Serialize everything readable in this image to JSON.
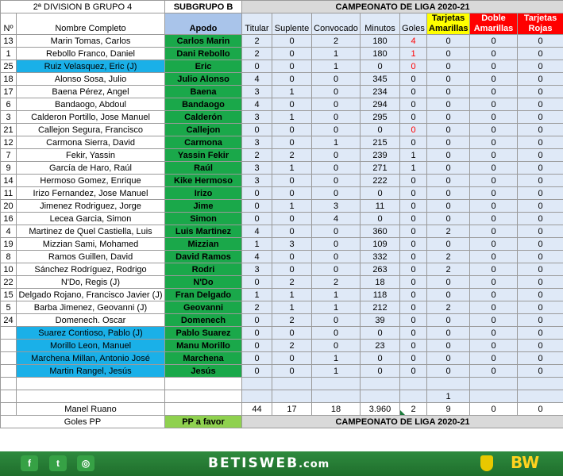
{
  "header": {
    "division": "2ª DIVISION B GRUPO 4",
    "subgrupo": "SUBGRUPO B",
    "campeonato": "CAMPEONATO  DE LIGA 2020-21",
    "cols": {
      "no": "Nº",
      "nombre": "Nombre Completo",
      "apodo": "Apodo",
      "titular": "Titular",
      "suplente": "Suplente",
      "convocado": "Convocado",
      "minutos": "Minutos",
      "goles": "Goles",
      "amarillas": "Tarjetas Amarillas",
      "doble": "Doble Amarillas",
      "rojas": "Tarjetas Rojas"
    }
  },
  "colors": {
    "green": "#1aa84a",
    "blue": "#1ab0e8",
    "yellow": "#ffff00",
    "red": "#ff0000",
    "apodo_header": "#a9c4ea"
  },
  "players": [
    {
      "no": "13",
      "name": "Marin Tomas, Carlos",
      "apodo": "Carlos Marin",
      "tit": "2",
      "sup": "0",
      "conv": "2",
      "min": "180",
      "gol": "4",
      "am": "0",
      "dob": "0",
      "roj": "0",
      "blue": false,
      "red": true
    },
    {
      "no": "1",
      "name": "Rebollo Franco, Daniel",
      "apodo": "Dani Rebollo",
      "tit": "2",
      "sup": "0",
      "conv": "1",
      "min": "180",
      "gol": "1",
      "am": "0",
      "dob": "0",
      "roj": "0",
      "blue": false,
      "red": true
    },
    {
      "no": "25",
      "name": "Ruiz Velasquez, Eric   (J)",
      "apodo": "Eric",
      "tit": "0",
      "sup": "0",
      "conv": "1",
      "min": "0",
      "gol": "0",
      "am": "0",
      "dob": "0",
      "roj": "0",
      "blue": true,
      "red": true
    },
    {
      "no": "18",
      "name": "Alonso Sosa, Julio",
      "apodo": "Julio Alonso",
      "tit": "4",
      "sup": "0",
      "conv": "0",
      "min": "345",
      "gol": "0",
      "am": "0",
      "dob": "0",
      "roj": "0",
      "blue": false,
      "red": false
    },
    {
      "no": "17",
      "name": "Baena Pérez, Angel",
      "apodo": "Baena",
      "tit": "3",
      "sup": "1",
      "conv": "0",
      "min": "234",
      "gol": "0",
      "am": "0",
      "dob": "0",
      "roj": "0",
      "blue": false,
      "red": false
    },
    {
      "no": "6",
      "name": "Bandaogo, Abdoul",
      "apodo": "Bandaogo",
      "tit": "4",
      "sup": "0",
      "conv": "0",
      "min": "294",
      "gol": "0",
      "am": "0",
      "dob": "0",
      "roj": "0",
      "blue": false,
      "red": false
    },
    {
      "no": "3",
      "name": "Calderon Portillo, Jose Manuel",
      "apodo": "Calderón",
      "tit": "3",
      "sup": "1",
      "conv": "0",
      "min": "295",
      "gol": "0",
      "am": "0",
      "dob": "0",
      "roj": "0",
      "blue": false,
      "red": false
    },
    {
      "no": "21",
      "name": "Callejon Segura, Francisco",
      "apodo": "Callejon",
      "tit": "0",
      "sup": "0",
      "conv": "0",
      "min": "0",
      "gol": "0",
      "am": "0",
      "dob": "0",
      "roj": "0",
      "blue": false,
      "red": true
    },
    {
      "no": "12",
      "name": "Carmona Sierra, David",
      "apodo": "Carmona",
      "tit": "3",
      "sup": "0",
      "conv": "1",
      "min": "215",
      "gol": "0",
      "am": "0",
      "dob": "0",
      "roj": "0",
      "blue": false,
      "red": false
    },
    {
      "no": "7",
      "name": "Fekir, Yassin",
      "apodo": "Yassin Fekir",
      "tit": "2",
      "sup": "2",
      "conv": "0",
      "min": "239",
      "gol": "1",
      "am": "0",
      "dob": "0",
      "roj": "0",
      "blue": false,
      "red": false
    },
    {
      "no": "9",
      "name": "García de Haro, Raúl",
      "apodo": "Raúl",
      "tit": "3",
      "sup": "1",
      "conv": "0",
      "min": "271",
      "gol": "1",
      "am": "0",
      "dob": "0",
      "roj": "0",
      "blue": false,
      "red": false
    },
    {
      "no": "14",
      "name": "Hermoso Gomez, Enrique",
      "apodo": "Kike Hermoso",
      "tit": "3",
      "sup": "0",
      "conv": "0",
      "min": "222",
      "gol": "0",
      "am": "0",
      "dob": "0",
      "roj": "0",
      "blue": false,
      "red": false
    },
    {
      "no": "11",
      "name": "Irizo Fernandez, Jose Manuel",
      "apodo": "Irizo",
      "tit": "0",
      "sup": "0",
      "conv": "0",
      "min": "0",
      "gol": "0",
      "am": "0",
      "dob": "0",
      "roj": "0",
      "blue": false,
      "red": false
    },
    {
      "no": "20",
      "name": "Jimenez Rodriguez, Jorge",
      "apodo": "Jime",
      "tit": "0",
      "sup": "1",
      "conv": "3",
      "min": "11",
      "gol": "0",
      "am": "0",
      "dob": "0",
      "roj": "0",
      "blue": false,
      "red": false
    },
    {
      "no": "16",
      "name": "Lecea Garcia, Simon",
      "apodo": "Simon",
      "tit": "0",
      "sup": "0",
      "conv": "4",
      "min": "0",
      "gol": "0",
      "am": "0",
      "dob": "0",
      "roj": "0",
      "blue": false,
      "red": false
    },
    {
      "no": "4",
      "name": "Martinez de Quel Castiella, Luis",
      "apodo": "Luis Martinez",
      "tit": "4",
      "sup": "0",
      "conv": "0",
      "min": "360",
      "gol": "0",
      "am": "2",
      "dob": "0",
      "roj": "0",
      "blue": false,
      "red": false
    },
    {
      "no": "19",
      "name": "Mizzian Sami, Mohamed",
      "apodo": "Mizzian",
      "tit": "1",
      "sup": "3",
      "conv": "0",
      "min": "109",
      "gol": "0",
      "am": "0",
      "dob": "0",
      "roj": "0",
      "blue": false,
      "red": false
    },
    {
      "no": "8",
      "name": "Ramos Guillen, David",
      "apodo": "David Ramos",
      "tit": "4",
      "sup": "0",
      "conv": "0",
      "min": "332",
      "gol": "0",
      "am": "2",
      "dob": "0",
      "roj": "0",
      "blue": false,
      "red": false
    },
    {
      "no": "10",
      "name": "Sánchez Rodríguez, Rodrigo",
      "apodo": "Rodri",
      "tit": "3",
      "sup": "0",
      "conv": "0",
      "min": "263",
      "gol": "0",
      "am": "2",
      "dob": "0",
      "roj": "0",
      "blue": false,
      "red": false
    },
    {
      "no": "22",
      "name": "N'Do, Regis (J)",
      "apodo": "N'Do",
      "tit": "0",
      "sup": "2",
      "conv": "2",
      "min": "18",
      "gol": "0",
      "am": "0",
      "dob": "0",
      "roj": "0",
      "blue": false,
      "red": false
    },
    {
      "no": "15",
      "name": "Delgado Rojano, Francisco Javier (J)",
      "apodo": "Fran Delgado",
      "tit": "1",
      "sup": "1",
      "conv": "1",
      "min": "118",
      "gol": "0",
      "am": "0",
      "dob": "0",
      "roj": "0",
      "blue": false,
      "red": false
    },
    {
      "no": "5",
      "name": "Barba Jimenez, Geovanni (J)",
      "apodo": "Geovanni",
      "tit": "2",
      "sup": "1",
      "conv": "1",
      "min": "212",
      "gol": "0",
      "am": "2",
      "dob": "0",
      "roj": "0",
      "blue": false,
      "red": false
    },
    {
      "no": "24",
      "name": "Domenech. Oscar",
      "apodo": "Domenech",
      "tit": "0",
      "sup": "2",
      "conv": "0",
      "min": "39",
      "gol": "0",
      "am": "0",
      "dob": "0",
      "roj": "0",
      "blue": false,
      "red": false
    },
    {
      "no": "",
      "name": "Suarez Contioso, Pablo (J)",
      "apodo": "Pablo Suarez",
      "tit": "0",
      "sup": "0",
      "conv": "0",
      "min": "0",
      "gol": "0",
      "am": "0",
      "dob": "0",
      "roj": "0",
      "blue": true,
      "red": false
    },
    {
      "no": "",
      "name": "Morillo Leon, Manuel",
      "apodo": "Manu Morillo",
      "tit": "0",
      "sup": "2",
      "conv": "0",
      "min": "23",
      "gol": "0",
      "am": "0",
      "dob": "0",
      "roj": "0",
      "blue": true,
      "red": false
    },
    {
      "no": "",
      "name": "Marchena Millan, Antonio José",
      "apodo": "Marchena",
      "tit": "0",
      "sup": "0",
      "conv": "1",
      "min": "0",
      "gol": "0",
      "am": "0",
      "dob": "0",
      "roj": "0",
      "blue": true,
      "red": false
    },
    {
      "no": "",
      "name": "Martin Rangel, Jesús",
      "apodo": "Jesús",
      "tit": "0",
      "sup": "0",
      "conv": "1",
      "min": "0",
      "gol": "0",
      "am": "0",
      "dob": "0",
      "roj": "0",
      "blue": true,
      "red": false
    }
  ],
  "extra": {
    "amarillas": "1"
  },
  "totals": {
    "label": "Manel Ruano",
    "tit": "44",
    "sup": "17",
    "conv": "18",
    "min": "3.960",
    "gol": "2",
    "am": "9",
    "dob": "0",
    "roj": "0"
  },
  "goles_pp": {
    "label": "Goles PP",
    "pp": "PP a favor",
    "campeonato": "CAMPEONATO  DE LIGA 2020-21"
  },
  "footer": {
    "facebook": "f",
    "twitter": "t",
    "instagram": "◎",
    "brand": "BETISWEB",
    "domain": ".com",
    "bw": "BW"
  }
}
